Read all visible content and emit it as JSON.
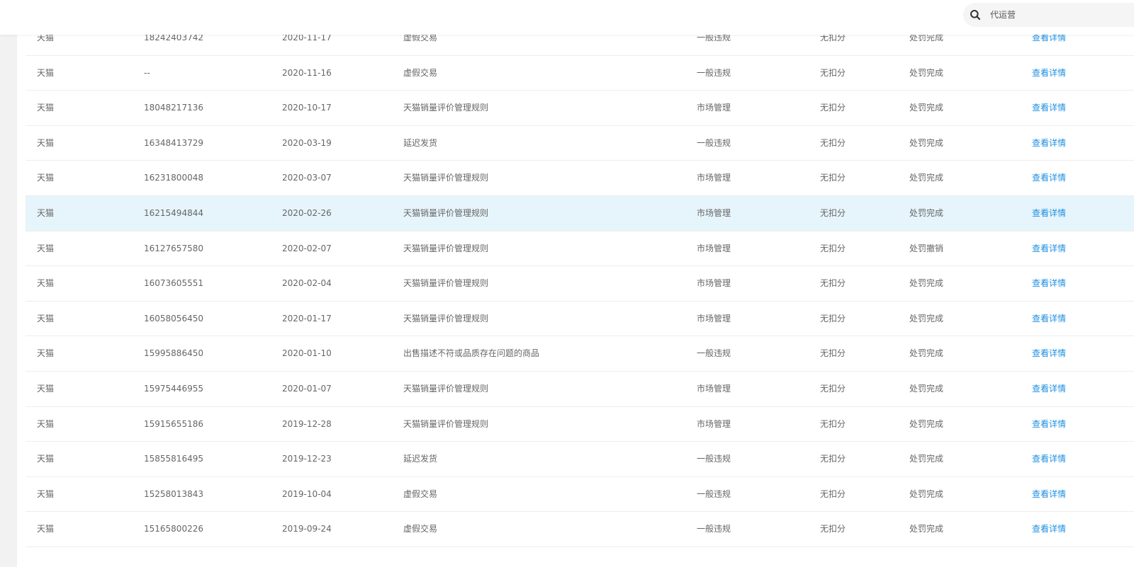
{
  "search": {
    "placeholder": "代运营"
  },
  "table": {
    "rows": [
      {
        "platform": "天猫",
        "id": "18242403742",
        "date": "2020-11-17",
        "reason": "虚假交易",
        "type": "一般违规",
        "score": "无扣分",
        "status": "处罚完成",
        "action": "查看详情"
      },
      {
        "platform": "天猫",
        "id": "--",
        "date": "2020-11-16",
        "reason": "虚假交易",
        "type": "一般违规",
        "score": "无扣分",
        "status": "处罚完成",
        "action": "查看详情"
      },
      {
        "platform": "天猫",
        "id": "18048217136",
        "date": "2020-10-17",
        "reason": "天猫销量评价管理规则",
        "type": "市场管理",
        "score": "无扣分",
        "status": "处罚完成",
        "action": "查看详情"
      },
      {
        "platform": "天猫",
        "id": "16348413729",
        "date": "2020-03-19",
        "reason": "延迟发货",
        "type": "一般违规",
        "score": "无扣分",
        "status": "处罚完成",
        "action": "查看详情"
      },
      {
        "platform": "天猫",
        "id": "16231800048",
        "date": "2020-03-07",
        "reason": "天猫销量评价管理规则",
        "type": "市场管理",
        "score": "无扣分",
        "status": "处罚完成",
        "action": "查看详情"
      },
      {
        "platform": "天猫",
        "id": "16215494844",
        "date": "2020-02-26",
        "reason": "天猫销量评价管理规则",
        "type": "市场管理",
        "score": "无扣分",
        "status": "处罚完成",
        "action": "查看详情",
        "highlighted": true
      },
      {
        "platform": "天猫",
        "id": "16127657580",
        "date": "2020-02-07",
        "reason": "天猫销量评价管理规则",
        "type": "市场管理",
        "score": "无扣分",
        "status": "处罚撤销",
        "action": "查看详情"
      },
      {
        "platform": "天猫",
        "id": "16073605551",
        "date": "2020-02-04",
        "reason": "天猫销量评价管理规则",
        "type": "市场管理",
        "score": "无扣分",
        "status": "处罚完成",
        "action": "查看详情"
      },
      {
        "platform": "天猫",
        "id": "16058056450",
        "date": "2020-01-17",
        "reason": "天猫销量评价管理规则",
        "type": "市场管理",
        "score": "无扣分",
        "status": "处罚完成",
        "action": "查看详情"
      },
      {
        "platform": "天猫",
        "id": "15995886450",
        "date": "2020-01-10",
        "reason": "出售描述不符或品质存在问题的商品",
        "type": "一般违规",
        "score": "无扣分",
        "status": "处罚完成",
        "action": "查看详情"
      },
      {
        "platform": "天猫",
        "id": "15975446955",
        "date": "2020-01-07",
        "reason": "天猫销量评价管理规则",
        "type": "市场管理",
        "score": "无扣分",
        "status": "处罚完成",
        "action": "查看详情"
      },
      {
        "platform": "天猫",
        "id": "15915655186",
        "date": "2019-12-28",
        "reason": "天猫销量评价管理规则",
        "type": "市场管理",
        "score": "无扣分",
        "status": "处罚完成",
        "action": "查看详情"
      },
      {
        "platform": "天猫",
        "id": "15855816495",
        "date": "2019-12-23",
        "reason": "延迟发货",
        "type": "一般违规",
        "score": "无扣分",
        "status": "处罚完成",
        "action": "查看详情"
      },
      {
        "platform": "天猫",
        "id": "15258013843",
        "date": "2019-10-04",
        "reason": "虚假交易",
        "type": "一般违规",
        "score": "无扣分",
        "status": "处罚完成",
        "action": "查看详情"
      },
      {
        "platform": "天猫",
        "id": "15165800226",
        "date": "2019-09-24",
        "reason": "虚假交易",
        "type": "一般违规",
        "score": "无扣分",
        "status": "处罚完成",
        "action": "查看详情"
      }
    ]
  }
}
